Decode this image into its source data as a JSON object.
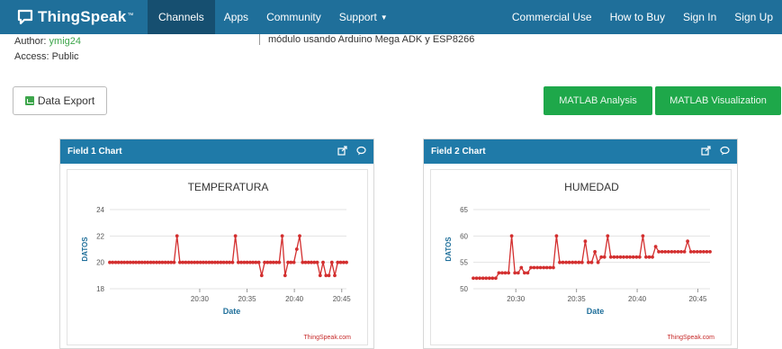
{
  "nav": {
    "brand": "ThingSpeak",
    "brand_tm": "™",
    "items": [
      "Channels",
      "Apps",
      "Community",
      "Support"
    ],
    "right": [
      "Commercial Use",
      "How to Buy",
      "Sign In",
      "Sign Up"
    ],
    "active": "Channels"
  },
  "meta": {
    "author_label": "Author:",
    "author": "ymig24",
    "access": "Access: Public",
    "description": "módulo usando Arduino Mega ADK y ESP8266"
  },
  "buttons": {
    "export": "Data Export",
    "matlab_analysis": "MATLAB Analysis",
    "matlab_visualization": "MATLAB Visualization"
  },
  "panels": [
    {
      "header": "Field 1 Chart"
    },
    {
      "header": "Field 2 Chart"
    }
  ],
  "icons": {
    "external": "external-link-icon",
    "comment": "comment-icon"
  },
  "colors": {
    "navbar": "#1f6f9a",
    "panel_header": "#1f7aa8",
    "series": "#d32f2f",
    "green_button": "#1ea84a"
  },
  "chart_data": [
    {
      "type": "line",
      "title": "TEMPERATURA",
      "xlabel": "Date",
      "ylabel": "DATOS",
      "credit": "ThingSpeak.com",
      "ylim": [
        18,
        24
      ],
      "yticks": [
        18,
        20,
        22,
        24
      ],
      "xticks": [
        "20:30",
        "20:35",
        "20:40",
        "20:45"
      ],
      "x_minutes": [
        20.5,
        45.5
      ],
      "series": [
        {
          "values": [
            20,
            20,
            20,
            20,
            20,
            20,
            20,
            20,
            20,
            20,
            20,
            20,
            20,
            20,
            20,
            20,
            20,
            20,
            20,
            20,
            20,
            20,
            20,
            22,
            20,
            20,
            20,
            20,
            20,
            20,
            20,
            20,
            20,
            20,
            20,
            20,
            20,
            20,
            20,
            20,
            20,
            20,
            20,
            22,
            20,
            20,
            20,
            20,
            20,
            20,
            20,
            20,
            19,
            20,
            20,
            20,
            20,
            20,
            20,
            22,
            19,
            20,
            20,
            20,
            21,
            22,
            20,
            20,
            20,
            20,
            20,
            20,
            19,
            20,
            19,
            19,
            20,
            19,
            20,
            20,
            20,
            20
          ]
        }
      ]
    },
    {
      "type": "line",
      "title": "HUMEDAD",
      "xlabel": "Date",
      "ylabel": "DATOS",
      "credit": "ThingSpeak.com",
      "ylim": [
        50,
        65
      ],
      "yticks": [
        50,
        55,
        60,
        65
      ],
      "xticks": [
        "20:30",
        "20:35",
        "20:40",
        "20:45"
      ],
      "x_minutes": [
        26.5,
        46.0
      ],
      "series": [
        {
          "values": [
            52,
            52,
            52,
            52,
            52,
            52,
            52,
            52,
            53,
            53,
            53,
            53,
            60,
            53,
            53,
            54,
            53,
            53,
            54,
            54,
            54,
            54,
            54,
            54,
            54,
            54,
            60,
            55,
            55,
            55,
            55,
            55,
            55,
            55,
            55,
            59,
            55,
            55,
            57,
            55,
            56,
            56,
            60,
            56,
            56,
            56,
            56,
            56,
            56,
            56,
            56,
            56,
            56,
            60,
            56,
            56,
            56,
            58,
            57,
            57,
            57,
            57,
            57,
            57,
            57,
            57,
            57,
            59,
            57,
            57,
            57,
            57,
            57,
            57,
            57
          ]
        }
      ]
    }
  ]
}
